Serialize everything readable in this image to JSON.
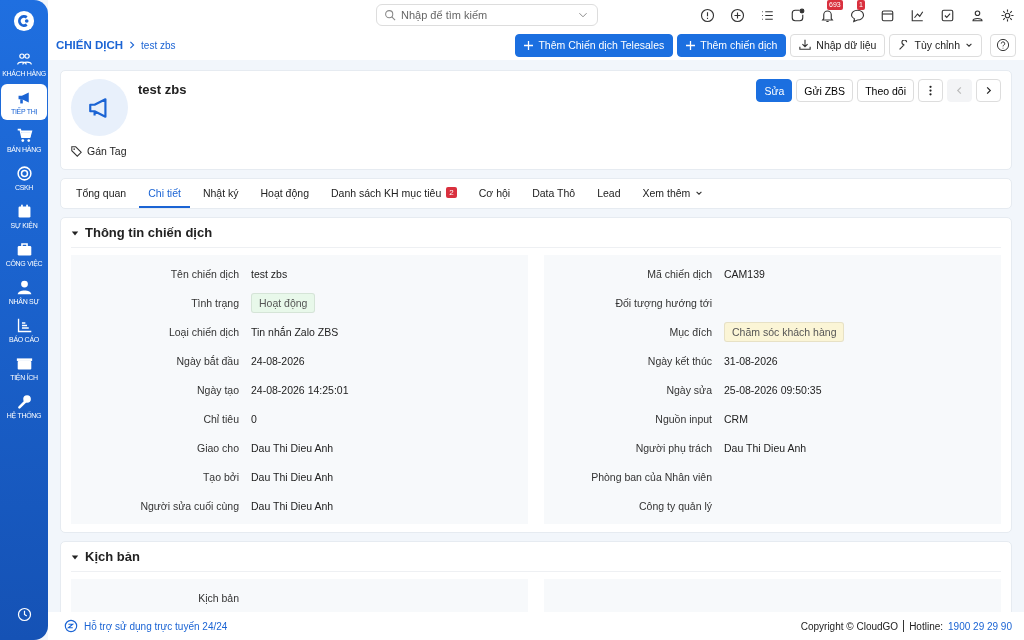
{
  "sidebar": {
    "items": [
      {
        "label": "KHÁCH HÀNG",
        "selected": false
      },
      {
        "label": "TIẾP THỊ",
        "selected": true
      },
      {
        "label": "BÁN HÀNG",
        "selected": false
      },
      {
        "label": "CSKH",
        "selected": false
      },
      {
        "label": "SỰ KIỆN",
        "selected": false
      },
      {
        "label": "CÔNG VIỆC",
        "selected": false
      },
      {
        "label": "NHÂN SỰ",
        "selected": false
      },
      {
        "label": "BÁO CÁO",
        "selected": false
      },
      {
        "label": "TIỆN ÍCH",
        "selected": false
      },
      {
        "label": "HỆ THỐNG",
        "selected": false
      }
    ]
  },
  "top_bar": {
    "search": {
      "placeholder": "Nhập để tìm kiếm"
    },
    "notification_badge": "693",
    "chat_badge": "1"
  },
  "breadcrumb": {
    "parent": "CHIẾN DỊCH",
    "current": "test zbs"
  },
  "actions": [
    {
      "label": "Thêm Chiến dịch Telesales",
      "kind": "primary"
    },
    {
      "label": "Thêm chiến dịch",
      "kind": "primary"
    },
    {
      "label": "Nhập dữ liệu",
      "kind": "import"
    },
    {
      "label": "Tùy chỉnh",
      "kind": "customize"
    }
  ],
  "record": {
    "title": "test zbs",
    "tag_label": "Gán Tag",
    "buttons": [
      {
        "label": "Sửa",
        "primary": true
      },
      {
        "label": "Gửi ZBS",
        "primary": false
      },
      {
        "label": "Theo dõi",
        "primary": false
      }
    ],
    "prev_disabled": true,
    "next_disabled": false
  },
  "tabs": [
    {
      "label": "Tổng quan",
      "selected": false
    },
    {
      "label": "Chi tiết",
      "selected": true
    },
    {
      "label": "Nhật ký",
      "selected": false
    },
    {
      "label": "Hoạt động",
      "selected": false
    },
    {
      "label": "Danh sách KH mục tiêu",
      "selected": false,
      "badge": "2"
    },
    {
      "label": "Cơ hội",
      "selected": false
    },
    {
      "label": "Data Thô",
      "selected": false
    },
    {
      "label": "Lead",
      "selected": false
    },
    {
      "label": "Xem thêm",
      "selected": false,
      "dropdown": true
    }
  ],
  "info_section": {
    "title": "Thông tin chiến dịch",
    "expanded": true,
    "left_fields": [
      {
        "label": "Tên chiến dịch",
        "value": "test zbs",
        "kind": "text"
      },
      {
        "label": "Tình trạng",
        "value": "Hoạt động",
        "kind": "tag",
        "color": "#e8f8ea"
      },
      {
        "label": "Loại chiến dịch",
        "value": "Tin nhắn Zalo ZBS",
        "kind": "text"
      },
      {
        "label": "Ngày bắt đầu",
        "value": "24-08-2026",
        "kind": "text"
      },
      {
        "label": "Ngày tạo",
        "value": "24-08-2026 14:25:01",
        "kind": "text"
      },
      {
        "label": "Chỉ tiêu",
        "value": "0",
        "kind": "text"
      },
      {
        "label": "Giao cho",
        "value": "Dau Thi Dieu Anh",
        "kind": "text"
      },
      {
        "label": "Tạo bởi",
        "value": "Dau Thi Dieu Anh",
        "kind": "text"
      },
      {
        "label": "Người sửa cuối cùng",
        "value": "Dau Thi Dieu Anh",
        "kind": "text"
      }
    ],
    "right_fields": [
      {
        "label": "Mã chiến dịch",
        "value": "CAM139",
        "kind": "text"
      },
      {
        "label": "Đối tượng hướng tới"
      },
      {
        "label": "Mục đích",
        "value": "Chăm sóc khách hàng",
        "kind": "tag",
        "color": "#fbf5d6"
      },
      {
        "label": "Ngày kết thúc",
        "value": "31-08-2026",
        "kind": "text"
      },
      {
        "label": "Ngày sửa",
        "value": "25-08-2026 09:50:35",
        "kind": "text"
      },
      {
        "label": "Nguồn input",
        "value": "CRM",
        "kind": "text"
      },
      {
        "label": "Người phụ trách",
        "value": "Dau Thi Dieu Anh",
        "kind": "text"
      },
      {
        "label": "Phòng ban của Nhân viên"
      },
      {
        "label": "Công ty quản lý"
      }
    ]
  },
  "script_section": {
    "title": "Kịch bản",
    "expanded": true,
    "left_fields": [
      {
        "label": "Kịch bản"
      }
    ]
  },
  "footer": {
    "support": "Hỗ trợ sử dụng trực tuyến 24/24",
    "copyright": "Copyright © CloudGO",
    "hotline_label": "Hotline:",
    "hotline": "1900 29 29 90"
  }
}
